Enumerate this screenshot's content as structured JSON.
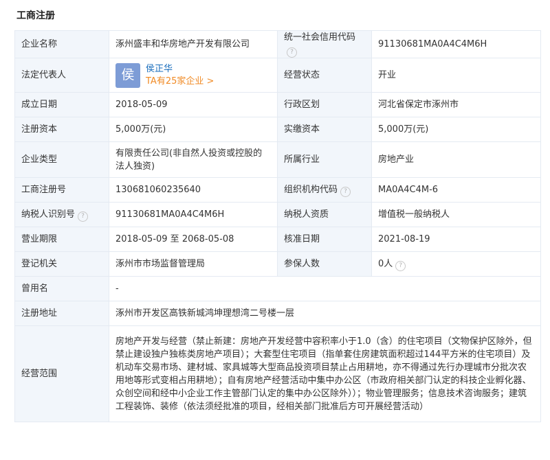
{
  "section": {
    "title": "工商注册"
  },
  "rows": {
    "company_name": {
      "label": "企业名称",
      "value": "涿州盛丰和华房地产开发有限公司"
    },
    "credit_code": {
      "label": "统一社会信用代码",
      "value": "91130681MA0A4C4M6H"
    },
    "legal_rep": {
      "label": "法定代表人",
      "avatar_char": "侯",
      "name": "侯正华",
      "link": "TA有25家企业 >"
    },
    "status": {
      "label": "经营状态",
      "value": "开业"
    },
    "established": {
      "label": "成立日期",
      "value": "2018-05-09"
    },
    "region": {
      "label": "行政区划",
      "value": "河北省保定市涿州市"
    },
    "registered_capital": {
      "label": "注册资本",
      "value": "5,000万(元)"
    },
    "paid_capital": {
      "label": "实缴资本",
      "value": "5,000万(元)"
    },
    "company_type": {
      "label": "企业类型",
      "value": "有限责任公司(非自然人投资或控股的法人独资)"
    },
    "industry": {
      "label": "所属行业",
      "value": "房地产业"
    },
    "reg_number": {
      "label": "工商注册号",
      "value": "130681060235640"
    },
    "org_code": {
      "label": "组织机构代码",
      "value": "MA0A4C4M-6"
    },
    "taxpayer_id": {
      "label": "纳税人识别号",
      "value": "91130681MA0A4C4M6H"
    },
    "taxpayer_quality": {
      "label": "纳税人资质",
      "value": "增值税一般纳税人"
    },
    "business_term": {
      "label": "营业期限",
      "value": "2018-05-09 至 2068-05-08"
    },
    "approval_date": {
      "label": "核准日期",
      "value": "2021-08-19"
    },
    "authority": {
      "label": "登记机关",
      "value": "涿州市市场监督管理局"
    },
    "insured": {
      "label": "参保人数",
      "value": "0人"
    },
    "former_name": {
      "label": "曾用名",
      "value": "-"
    },
    "address": {
      "label": "注册地址",
      "value": "涿州市开发区高铁新城鸿坤理想湾二号楼一层"
    },
    "scope": {
      "label": "经营范围",
      "value": "房地产开发与经营（禁止新建：房地产开发经营中容积率小于1.0（含）的住宅项目（文物保护区除外，但禁止建设独户独栋类房地产项目）；大套型住宅项目（指单套住房建筑面积超过144平方米的住宅项目）及机动车交易市场、建材城、家具城等大型商品投资项目禁止占用耕地，亦不得通过先行办理城市分批次农用地等形式变相占用耕地）；自有房地产经营活动中集中办公区（市政府相关部门认定的科技企业孵化器、众创空间和经中小企业工作主管部门认定的集中办公区除外））；物业管理服务；信息技术咨询服务；建筑工程装饰、装修（依法须经批准的项目，经相关部门批准后方可开展经营活动）"
    }
  },
  "help_mark": "?"
}
